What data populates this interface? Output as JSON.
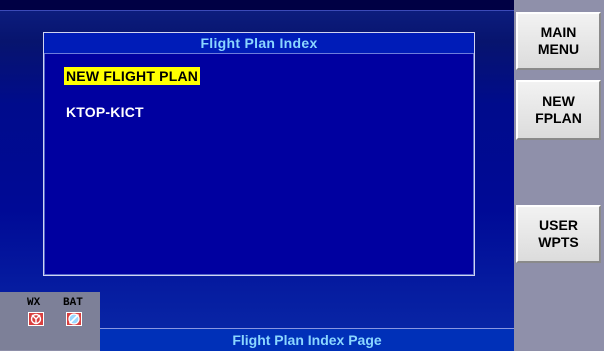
{
  "panel": {
    "title": "Flight Plan Index",
    "items": [
      {
        "label": "NEW FLIGHT PLAN",
        "selected": true
      },
      {
        "label": "KTOP-KICT",
        "selected": false
      }
    ]
  },
  "softkeys": {
    "main_menu": "MAIN\nMENU",
    "new_fplan": "NEW\nFPLAN",
    "user_wpts": "USER\nWPTS"
  },
  "status": {
    "wx_label": "WX",
    "bat_label": "BAT",
    "wx_icon": "weather-fault-icon",
    "bat_icon": "battery-fault-icon"
  },
  "footer": {
    "page_title": "Flight Plan Index Page"
  },
  "colors": {
    "background": "#000a96",
    "title_text": "#8ad6ff",
    "selection": "#ffff00"
  }
}
